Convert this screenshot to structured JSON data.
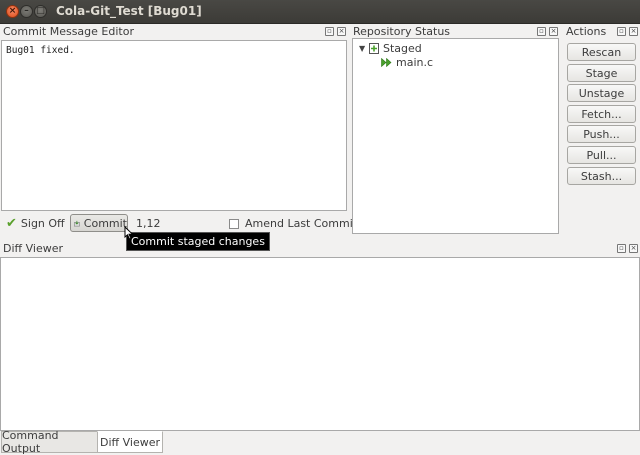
{
  "window": {
    "title": "Cola-Git_Test [Bug01]"
  },
  "commit_editor": {
    "title": "Commit Message Editor",
    "text": "Bug01 fixed.",
    "sign_off_label": "Sign Off",
    "commit_label": "Commit",
    "cursor_position": "1,12",
    "amend_label": "Amend Last Commit",
    "tooltip": "Commit staged changes"
  },
  "repo_status": {
    "title": "Repository Status",
    "section_label": "Staged",
    "files": [
      "main.c"
    ]
  },
  "actions": {
    "title": "Actions",
    "buttons": [
      "Rescan",
      "Stage",
      "Unstage",
      "Fetch...",
      "Push...",
      "Pull...",
      "Stash..."
    ]
  },
  "diff_viewer": {
    "title": "Diff Viewer"
  },
  "bottom_tabs": [
    "Command Output",
    "Diff Viewer"
  ],
  "colors": {
    "staged_icon": "#4aa02c",
    "titlebar": "#3c3b37",
    "close_button": "#df4a16"
  }
}
